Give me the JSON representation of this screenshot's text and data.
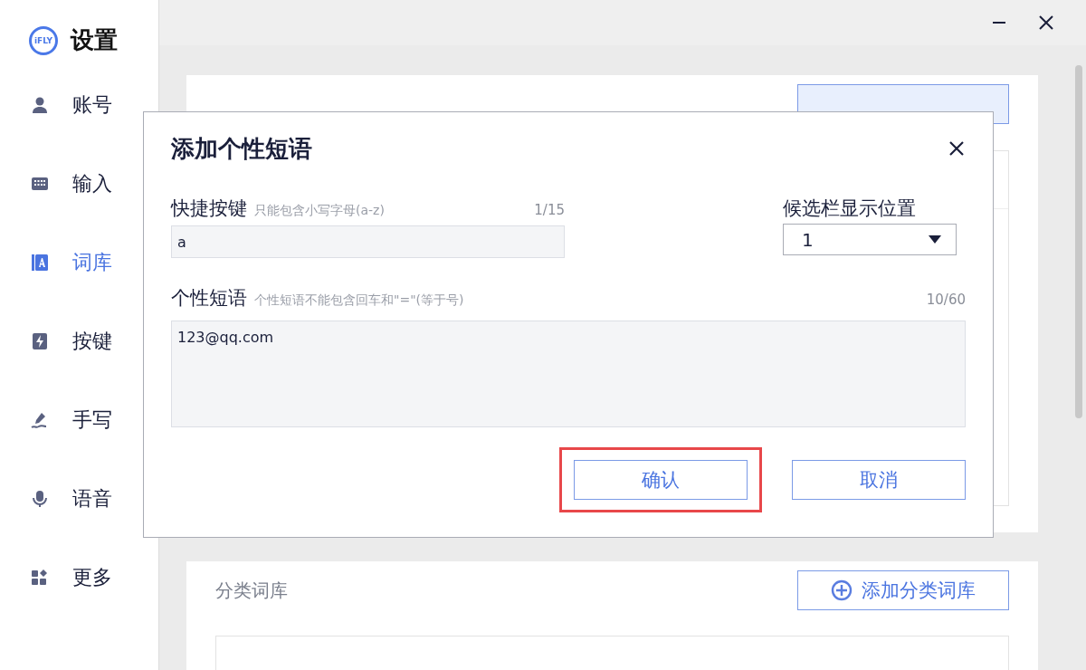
{
  "app": {
    "logo_text": "iFLY",
    "title": "设置"
  },
  "sidebar": {
    "items": [
      {
        "label": "账号",
        "kind": "person",
        "selected": false
      },
      {
        "label": "输入",
        "kind": "keyboard",
        "selected": false
      },
      {
        "label": "词库",
        "kind": "book",
        "selected": true
      },
      {
        "label": "按键",
        "kind": "bolt",
        "selected": false
      },
      {
        "label": "手写",
        "kind": "pen",
        "selected": false
      },
      {
        "label": "语音",
        "kind": "mic",
        "selected": false
      },
      {
        "label": "更多",
        "kind": "grid",
        "selected": false
      }
    ]
  },
  "category_section": {
    "title": "分类词库",
    "add_button": "添加分类词库"
  },
  "dialog": {
    "title": "添加个性短语",
    "shortcut": {
      "label": "快捷按键",
      "hint": "只能包含小写字母(a-z)",
      "counter": "1/15",
      "value": "a"
    },
    "position": {
      "label": "候选栏显示位置",
      "value": "1"
    },
    "phrase": {
      "label": "个性短语",
      "hint": "个性短语不能包含回车和\"=\"(等于号)",
      "counter": "10/60",
      "value": "123@qq.com"
    },
    "buttons": [
      {
        "label": "确认",
        "highlighted": true
      },
      {
        "label": "取消",
        "highlighted": false
      }
    ]
  }
}
